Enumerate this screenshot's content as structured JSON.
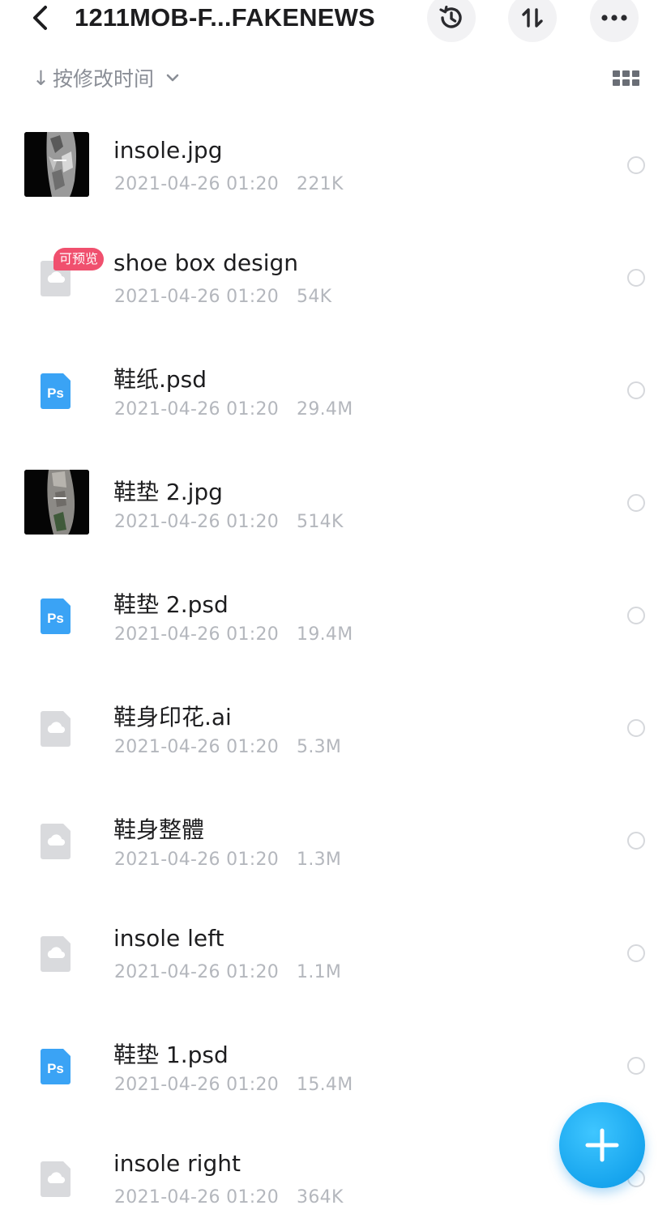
{
  "header": {
    "title": "1211MOB-F...FAKENEWS",
    "back_icon": "chevron-left-icon",
    "history_icon": "history-icon",
    "sort_icon": "sort-arrows-icon",
    "more_icon": "more-dots-icon"
  },
  "sortbar": {
    "arrow": "↓",
    "label": "按修改时间",
    "dropdown_icon": "chevron-down-icon",
    "view_icon": "grid-view-icon"
  },
  "badge": {
    "text": "可预览"
  },
  "files": [
    {
      "name": "insole.jpg",
      "date": "2021-04-26 01:20",
      "size": "221K",
      "icon": "image-thumbnail"
    },
    {
      "name": "shoe box design",
      "date": "2021-04-26 01:20",
      "size": "54K",
      "icon": "cloud-file-icon"
    },
    {
      "name": "鞋纸.psd",
      "date": "2021-04-26 01:20",
      "size": "29.4M",
      "icon": "photoshop-icon"
    },
    {
      "name": "鞋垫 2.jpg",
      "date": "2021-04-26 01:20",
      "size": "514K",
      "icon": "image-thumbnail"
    },
    {
      "name": "鞋垫 2.psd",
      "date": "2021-04-26 01:20",
      "size": "19.4M",
      "icon": "photoshop-icon"
    },
    {
      "name": "鞋身印花.ai",
      "date": "2021-04-26 01:20",
      "size": "5.3M",
      "icon": "cloud-file-icon"
    },
    {
      "name": "鞋身整體",
      "date": "2021-04-26 01:20",
      "size": "1.3M",
      "icon": "cloud-file-icon"
    },
    {
      "name": "insole left",
      "date": "2021-04-26 01:20",
      "size": "1.1M",
      "icon": "cloud-file-icon"
    },
    {
      "name": "鞋垫 1.psd",
      "date": "2021-04-26 01:20",
      "size": "15.4M",
      "icon": "photoshop-icon"
    },
    {
      "name": "insole right",
      "date": "2021-04-26 01:20",
      "size": "364K",
      "icon": "cloud-file-icon"
    }
  ],
  "ps_label": "Ps",
  "fab": {
    "icon": "plus-icon"
  },
  "colors": {
    "accent": "#1ba8f0",
    "badge": "#f0506e",
    "ps_blue": "#3aa3f5",
    "meta_gray": "#b4b7bd"
  }
}
